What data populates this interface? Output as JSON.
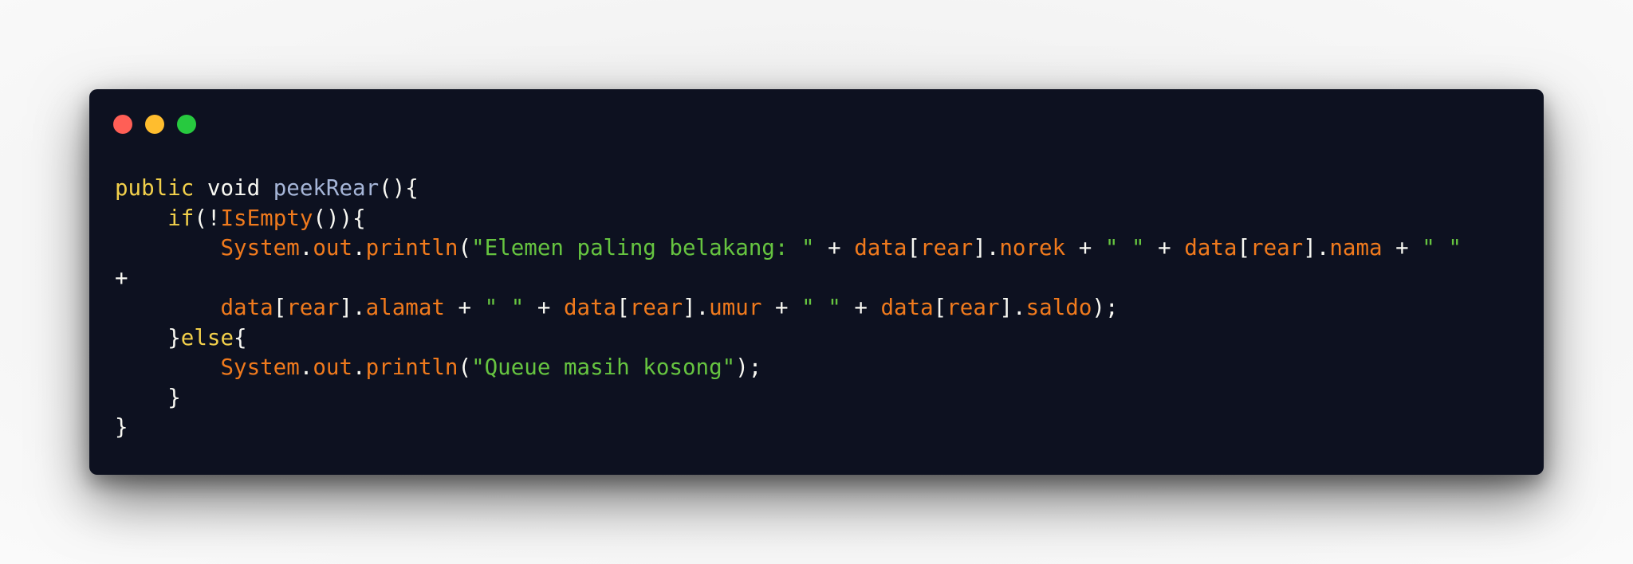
{
  "window": {
    "controls": {
      "close": "close",
      "minimize": "minimize",
      "maximize": "maximize"
    }
  },
  "code": {
    "language": "java",
    "lines": [
      "public void peekRear(){",
      "    if(!IsEmpty()){",
      "        System.out.println(\"Elemen paling belakang: \" + data[rear].norek + \" \" + data[rear].nama + \" \"",
      "+",
      "        data[rear].alamat + \" \" + data[rear].umur + \" \" + data[rear].saldo);",
      "    }else{",
      "        System.out.println(\"Queue masih kosong\");",
      "    }",
      "}"
    ]
  },
  "colors": {
    "background": "#0d1120",
    "keyword": "#f2d04b",
    "function": "#a6b6d8",
    "identifier": "#f07a1d",
    "string": "#66c440",
    "text": "#f8f8f2",
    "close_dot": "#ff5f56",
    "minimize_dot": "#ffbd2e",
    "maximize_dot": "#27c93f"
  }
}
